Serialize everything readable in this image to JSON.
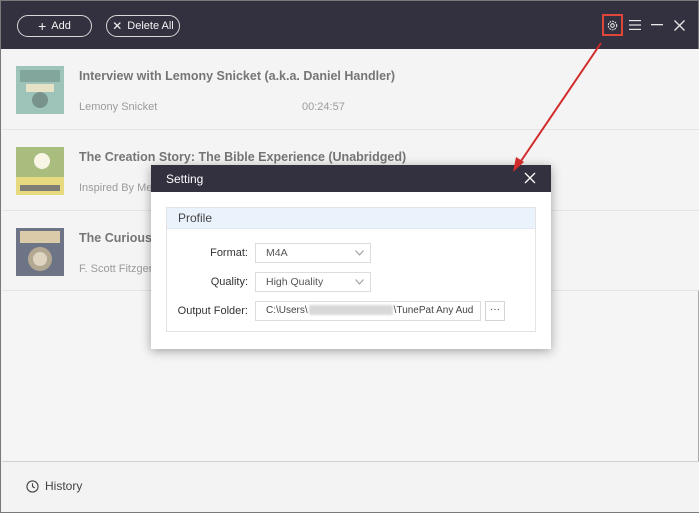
{
  "toolbar": {
    "add_label": "Add",
    "add_icon": "plus-icon",
    "delete_all_label": "Delete All",
    "delete_all_icon": "x-icon",
    "settings_icon": "gear-icon",
    "menu_icon": "hamburger-menu-icon",
    "minimize_icon": "minimize-icon",
    "close_icon": "close-icon",
    "highlight_color": "#e0453a"
  },
  "items": [
    {
      "title": "Interview with Lemony Snicket (a.k.a. Daniel Handler)",
      "author": "Lemony Snicket",
      "duration": "00:24:57"
    },
    {
      "title": "The Creation Story: The Bible Experience (Unabridged)",
      "author": "Inspired By Me",
      "duration": ""
    },
    {
      "title": "The Curious",
      "author": "F. Scott Fitzgera",
      "duration": ""
    }
  ],
  "footer": {
    "history_label": "History",
    "history_icon": "clock-icon"
  },
  "dialog": {
    "title": "Setting",
    "section_label": "Profile",
    "format_label": "Format:",
    "format_value": "M4A",
    "quality_label": "Quality:",
    "quality_value": "High Quality",
    "output_label": "Output Folder:",
    "output_prefix": "C:\\Users\\",
    "output_suffix": "\\TunePat Any Aud",
    "browse_label": "···"
  },
  "colors": {
    "titlebar": "#33303f",
    "arrow": "#d22b2b"
  }
}
